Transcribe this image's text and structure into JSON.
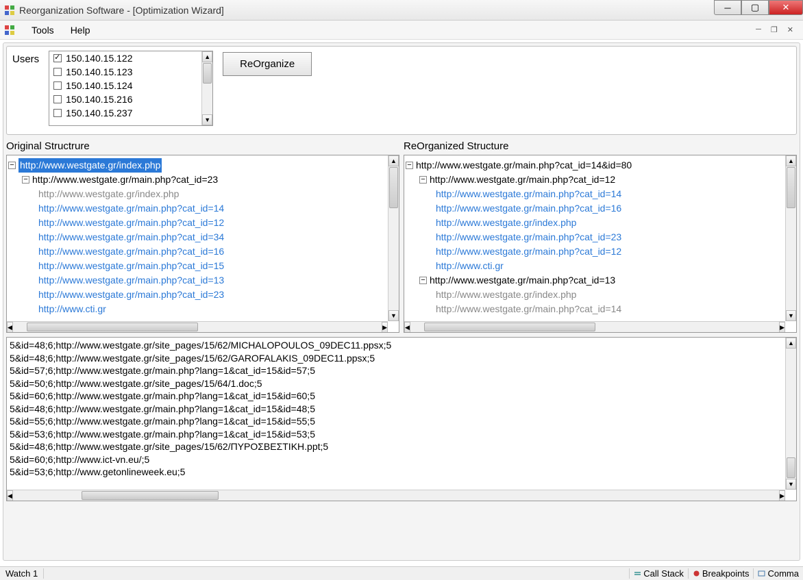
{
  "window": {
    "title": "Reorganization Software - [Optimization Wizard]"
  },
  "menu": {
    "tools": "Tools",
    "help": "Help"
  },
  "users": {
    "label": "Users",
    "items": [
      {
        "ip": "150.140.15.122",
        "checked": true
      },
      {
        "ip": "150.140.15.123",
        "checked": false
      },
      {
        "ip": "150.140.15.124",
        "checked": false
      },
      {
        "ip": "150.140.15.216",
        "checked": false
      },
      {
        "ip": "150.140.15.237",
        "checked": false
      }
    ]
  },
  "reorganize_label": "ReOrganize",
  "original": {
    "label": "Original Structrure",
    "root": "http://www.westgate.gr/index.php",
    "child": "http://www.westgate.gr/main.php?cat_id=23",
    "leaves": [
      {
        "text": "http://www.westgate.gr/index.php",
        "style": "gray"
      },
      {
        "text": "http://www.westgate.gr/main.php?cat_id=14",
        "style": "link"
      },
      {
        "text": "http://www.westgate.gr/main.php?cat_id=12",
        "style": "link"
      },
      {
        "text": "http://www.westgate.gr/main.php?cat_id=34",
        "style": "link"
      },
      {
        "text": "http://www.westgate.gr/main.php?cat_id=16",
        "style": "link"
      },
      {
        "text": "http://www.westgate.gr/main.php?cat_id=15",
        "style": "link"
      },
      {
        "text": "http://www.westgate.gr/main.php?cat_id=13",
        "style": "link"
      },
      {
        "text": "http://www.westgate.gr/main.php?cat_id=23",
        "style": "link"
      },
      {
        "text": "http://www.cti.gr",
        "style": "link"
      }
    ]
  },
  "reorganized": {
    "label": "ReOrganized Structure",
    "root": "http://www.westgate.gr/main.php?cat_id=14&id=80",
    "child1": "http://www.westgate.gr/main.php?cat_id=12",
    "leaves1": [
      {
        "text": "http://www.westgate.gr/main.php?cat_id=14",
        "style": "link"
      },
      {
        "text": "http://www.westgate.gr/main.php?cat_id=16",
        "style": "link"
      },
      {
        "text": "http://www.westgate.gr/index.php",
        "style": "link"
      },
      {
        "text": "http://www.westgate.gr/main.php?cat_id=23",
        "style": "link"
      },
      {
        "text": "http://www.westgate.gr/main.php?cat_id=12",
        "style": "link"
      },
      {
        "text": "http://www.cti.gr",
        "style": "link"
      }
    ],
    "child2": "http://www.westgate.gr/main.php?cat_id=13",
    "leaves2": [
      {
        "text": "http://www.westgate.gr/index.php",
        "style": "gray"
      },
      {
        "text": "http://www.westgate.gr/main.php?cat_id=14",
        "style": "gray"
      }
    ]
  },
  "log": [
    "5&id=48;6;http://www.westgate.gr/site_pages/15/62/MICHALOPOULOS_09DEC11.ppsx;5",
    "5&id=48;6;http://www.westgate.gr/site_pages/15/62/GAROFALAKIS_09DEC11.ppsx;5",
    "5&id=57;6;http://www.westgate.gr/main.php?lang=1&cat_id=15&id=57;5",
    "5&id=50;6;http://www.westgate.gr/site_pages/15/64/1.doc;5",
    "5&id=60;6;http://www.westgate.gr/main.php?lang=1&cat_id=15&id=60;5",
    "5&id=48;6;http://www.westgate.gr/main.php?lang=1&cat_id=15&id=48;5",
    "5&id=55;6;http://www.westgate.gr/main.php?lang=1&cat_id=15&id=55;5",
    "5&id=53;6;http://www.westgate.gr/main.php?lang=1&cat_id=15&id=53;5",
    "5&id=48;6;http://www.westgate.gr/site_pages/15/62/ΠΥΡΟΣΒΕΣΤΙΚΗ.ppt;5",
    "5&id=60;6;http://www.ict-vn.eu/;5",
    "5&id=53;6;http://www.getonlineweek.eu;5"
  ],
  "statusbar": {
    "watch": "Watch 1",
    "callstack": "Call Stack",
    "breakpoints": "Breakpoints",
    "command": "Comma"
  }
}
